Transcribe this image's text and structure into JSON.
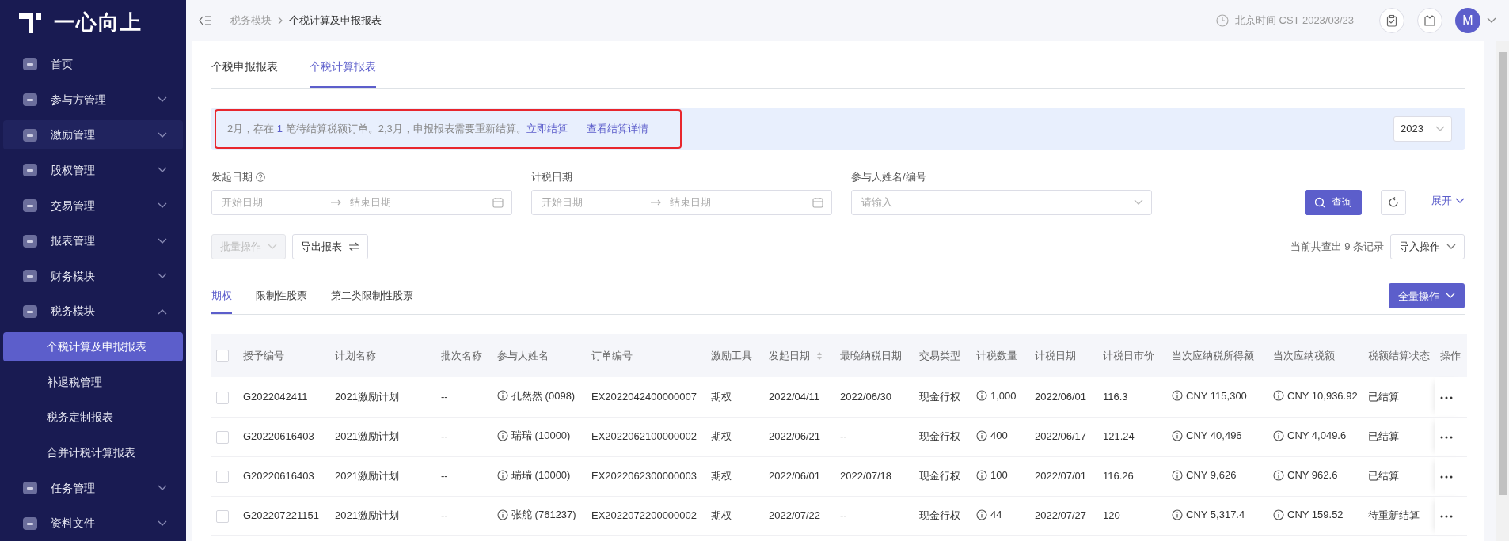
{
  "sidebar": {
    "logo": "一心向上",
    "items": [
      {
        "label": "首页"
      },
      {
        "label": "参与方管理",
        "expanded": false
      },
      {
        "label": "激励管理",
        "expanded": false,
        "highlighted": true
      },
      {
        "label": "股权管理",
        "expanded": false
      },
      {
        "label": "交易管理",
        "expanded": false
      },
      {
        "label": "报表管理",
        "expanded": false
      },
      {
        "label": "财务模块",
        "expanded": false
      },
      {
        "label": "税务模块",
        "expanded": true,
        "children": [
          {
            "label": "个税计算及申报报表",
            "selected": true
          },
          {
            "label": "补退税管理",
            "selected": false
          },
          {
            "label": "税务定制报表",
            "selected": false
          },
          {
            "label": "合并计税计算报表",
            "selected": false
          }
        ]
      },
      {
        "label": "任务管理",
        "expanded": false
      },
      {
        "label": "资料文件",
        "expanded": false
      }
    ]
  },
  "header": {
    "breadcrumb": [
      "税务模块",
      "个税计算及申报报表"
    ],
    "clock": "北京时间 CST 2023/03/23",
    "avatar": "M"
  },
  "tabs": [
    {
      "label": "个税申报报表",
      "selected": false
    },
    {
      "label": "个税计算报表",
      "selected": true
    }
  ],
  "alert": {
    "before": "2月，存在 ",
    "count": "1",
    "after": " 笔待结算税额订单。2,3月，申报报表需要重新结算。",
    "links": [
      "立即结算",
      "查看结算详情"
    ],
    "year": "2023"
  },
  "filters": [
    {
      "label": "发起日期",
      "help": true,
      "start_placeholder": "开始日期",
      "end_placeholder": "结束日期"
    },
    {
      "label": "计税日期",
      "help": false,
      "start_placeholder": "开始日期",
      "end_placeholder": "结束日期"
    }
  ],
  "participant_filter": {
    "label": "参与人姓名/编号",
    "placeholder": "请输入"
  },
  "search_button": "查询",
  "expand_link": "展开",
  "batch_button": {
    "label": "批量操作",
    "disabled": true
  },
  "export_button": "导出报表",
  "record_count": "当前共查出 9 条记录",
  "import_button": "导入操作",
  "sub_tabs": [
    {
      "label": "期权",
      "selected": true
    },
    {
      "label": "限制性股票",
      "selected": false
    },
    {
      "label": "第二类限制性股票",
      "selected": false
    }
  ],
  "bulk_button": "全量操作",
  "table": {
    "all_checked": false,
    "columns": [
      {
        "label": "授予编号"
      },
      {
        "label": "计划名称"
      },
      {
        "label": "批次名称"
      },
      {
        "label": "参与人姓名",
        "cell_info": true
      },
      {
        "label": "订单编号"
      },
      {
        "label": "激励工具"
      },
      {
        "label": "发起日期",
        "sortable": true
      },
      {
        "label": "最晚纳税日期"
      },
      {
        "label": "交易类型"
      },
      {
        "label": "计税数量",
        "cell_info": true
      },
      {
        "label": "计税日期"
      },
      {
        "label": "计税日市价"
      },
      {
        "label": "当次应纳税所得额",
        "cell_info": true
      },
      {
        "label": "当次应纳税额",
        "cell_info": true
      },
      {
        "label": "税额结算状态"
      },
      {
        "label": "操作"
      }
    ],
    "rows": [
      {
        "checked": false,
        "cells": [
          "G2022042411",
          "2021激励计划",
          "--",
          "孔然然 (0098)",
          "EX2022042400000007",
          "期权",
          "2022/04/11",
          "2022/06/30",
          "现金行权",
          "1,000",
          "2022/06/01",
          "116.3",
          "CNY 115,300",
          "CNY 10,936.92",
          "已结算"
        ]
      },
      {
        "checked": false,
        "cells": [
          "G20220616403",
          "2021激励计划",
          "--",
          "瑞瑞 (10000)",
          "EX2022062100000002",
          "期权",
          "2022/06/21",
          "--",
          "现金行权",
          "400",
          "2022/06/17",
          "121.24",
          "CNY 40,496",
          "CNY 4,049.6",
          "已结算"
        ]
      },
      {
        "checked": false,
        "cells": [
          "G20220616403",
          "2021激励计划",
          "--",
          "瑞瑞 (10000)",
          "EX2022062300000003",
          "期权",
          "2022/06/01",
          "2022/07/18",
          "现金行权",
          "100",
          "2022/07/01",
          "116.26",
          "CNY 9,626",
          "CNY 962.6",
          "已结算"
        ]
      },
      {
        "checked": false,
        "cells": [
          "G202207221151",
          "2021激励计划",
          "--",
          "张舵 (761237)",
          "EX2022072200000002",
          "期权",
          "2022/07/22",
          "--",
          "现金行权",
          "44",
          "2022/07/27",
          "120",
          "CNY 5,317.4",
          "CNY 159.52",
          "待重新结算"
        ]
      }
    ]
  }
}
